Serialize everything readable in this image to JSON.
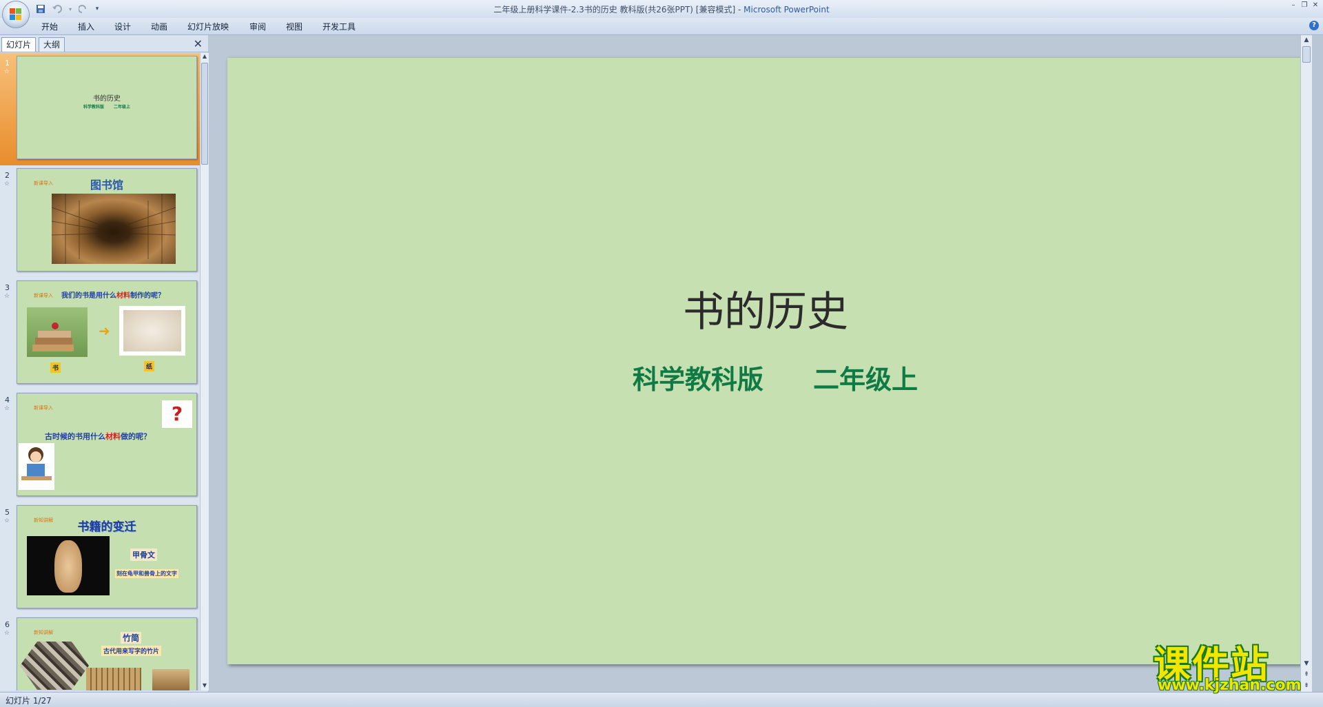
{
  "window": {
    "title": "二年级上册科学课件-2.3书的历史 教科版(共26张PPT) [兼容模式]",
    "app_name": "Microsoft PowerPoint"
  },
  "ribbon": {
    "tabs": [
      "开始",
      "插入",
      "设计",
      "动画",
      "幻灯片放映",
      "审阅",
      "视图",
      "开发工具"
    ]
  },
  "left_pane": {
    "tabs": [
      "幻灯片",
      "大纲"
    ],
    "slides": [
      {
        "num": "1",
        "title": "书的历史",
        "sub_a": "科学教科版",
        "sub_b": "二年级上"
      },
      {
        "num": "2",
        "tag": "新课导入",
        "title": "图书馆"
      },
      {
        "num": "3",
        "tag": "新课导入",
        "q_pre": "我们的书是用什么",
        "q_red": "材料",
        "q_post": "制作的呢？",
        "l1": "书",
        "l2": "纸"
      },
      {
        "num": "4",
        "tag": "新课导入",
        "q_pre": "古时候的书用什么",
        "q_red": "材料",
        "q_post": "做的呢？"
      },
      {
        "num": "5",
        "tag": "新知讲解",
        "title": "书籍的变迁",
        "label": "甲骨文",
        "desc": "刻在龟甲和兽骨上的文字"
      },
      {
        "num": "6",
        "tag": "新知讲解",
        "title": "竹简",
        "desc": "古代用来写字的竹片"
      }
    ]
  },
  "slide": {
    "title": "书的历史",
    "subtitle_left": "科学教科版",
    "subtitle_right": "二年级上"
  },
  "status": {
    "slide_counter": "幻灯片 1/27"
  },
  "watermark": {
    "cn": "课件站",
    "url": "www.kjzhan.com"
  },
  "colors": {
    "slide_bg": "#c6e0b2",
    "subtitle": "#107a45",
    "selected_thumb": "#e88d2c"
  }
}
